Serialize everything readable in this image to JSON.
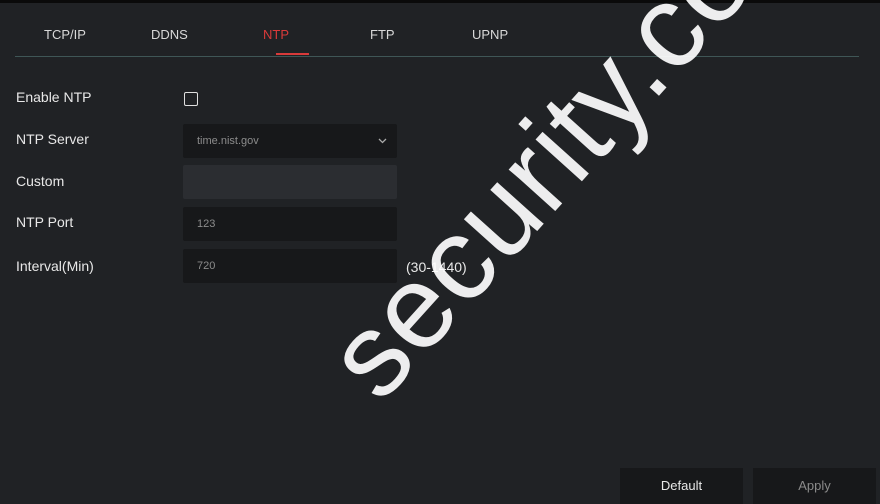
{
  "tabs": [
    {
      "label": "TCP/IP"
    },
    {
      "label": "DDNS"
    },
    {
      "label": "NTP"
    },
    {
      "label": "FTP"
    },
    {
      "label": "UPNP"
    }
  ],
  "active_tab": "NTP",
  "form": {
    "enable_ntp_label": "Enable NTP",
    "enable_ntp_checked": false,
    "ntp_server_label": "NTP Server",
    "ntp_server_value": "time.nist.gov",
    "custom_label": "Custom",
    "custom_value": "",
    "ntp_port_label": "NTP Port",
    "ntp_port_value": "123",
    "interval_label": "Interval(Min)",
    "interval_value": "720",
    "interval_hint": "(30-1440)"
  },
  "buttons": {
    "default_label": "Default",
    "apply_label": "Apply"
  },
  "watermark_text": "security.co",
  "colors": {
    "background": "#202225",
    "accent": "#d93a3a",
    "field_bg": "#17181a"
  }
}
